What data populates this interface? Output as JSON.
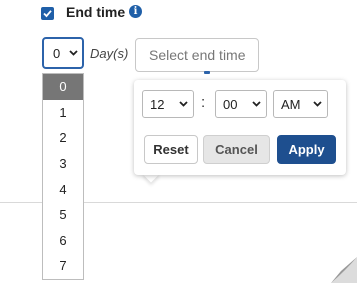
{
  "end_time": {
    "checked": true,
    "label": "End time",
    "info_icon": "info-icon",
    "info_glyph": "i"
  },
  "day_select": {
    "value": "0",
    "unit_label": "Day(s)",
    "options": [
      "0",
      "1",
      "2",
      "3",
      "4",
      "5",
      "6",
      "7"
    ],
    "selected_index": 0
  },
  "end_input": {
    "placeholder": "Select end time"
  },
  "time_picker": {
    "hour": "12",
    "separator": ":",
    "minute": "00",
    "period": "AM"
  },
  "buttons": {
    "reset": "Reset",
    "cancel": "Cancel",
    "apply": "Apply"
  },
  "colors": {
    "accent": "#1f5fa8",
    "apply_bg": "#1e4f8f",
    "selected_option_bg": "#767676"
  }
}
